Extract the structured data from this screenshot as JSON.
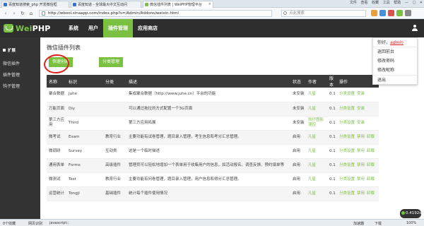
{
  "browser": {
    "tabs": [
      {
        "title": "百度知道搜索_php 开发微信框",
        "color": "#2e73d8"
      },
      {
        "title": "百度知道 - 全球最大中文互动问",
        "color": "#2e73d8"
      },
      {
        "title": "微信插件列表 | WeiPHP管理平台",
        "color": "#7ac142"
      }
    ],
    "window_controls": [
      "文件",
      "查看",
      "收藏",
      "工具",
      "帮助",
      "—",
      "□",
      "✕"
    ],
    "url": "http://wbool.sinaapp.com/index.php?s=/Admin/Addons/weixin.html",
    "search_placeholder": "点此搜索"
  },
  "app": {
    "logo_wei": "Wei",
    "logo_php": "PHP",
    "menu": [
      "系统",
      "用户",
      "插件管理",
      "应用商店"
    ],
    "active_menu": "插件管理"
  },
  "sidebar": {
    "heading": "扩展",
    "items": [
      "微信插件",
      "插件管理",
      "钩子管理"
    ]
  },
  "main": {
    "title": "微信插件列表",
    "quick_create": "快速创建",
    "category_manage": "分类管理",
    "columns": [
      "名称",
      "标识",
      "分类",
      "描述",
      "状态",
      "作者",
      "版本",
      "操作"
    ],
    "rows": [
      {
        "name": "聚合数据",
        "id": "Juhe",
        "cat": "",
        "desc": "集成聚合数据（http://www.juhe.cn）平台的功能",
        "status": "未安装",
        "author": "凡星",
        "ver": "0.1",
        "ops": [
          "分类设置",
          "安装"
        ]
      },
      {
        "name": "万能页面",
        "id": "Diy",
        "cat": "",
        "desc": "可以通过拖拉的方式配置一个3G页面",
        "status": "未安装",
        "author": "凡星",
        "ver": "0.1",
        "ops": [
          "分类设置",
          "安装"
        ]
      },
      {
        "name": "第三方应用",
        "id": "Third",
        "cat": "",
        "desc": "第三方应用拓展",
        "status": "未安装",
        "author": "凯仔图影漫控",
        "ver": "0.1",
        "ops": [
          "分类设置",
          "安装"
        ]
      },
      {
        "name": "微考试",
        "id": "Exam",
        "cat": "教育行业",
        "desc": "主要功能有试卷管理，题目录入管理，考生信息和考分汇总管理。",
        "status": "启用",
        "author": "凡星",
        "ver": "0.1",
        "ops": [
          "分类设置",
          "禁用",
          "卸载"
        ]
      },
      {
        "name": "微调研",
        "id": "Survey",
        "cat": "互动类",
        "desc": "这是一个临时描述",
        "status": "启用",
        "author": "凡星",
        "ver": "0.1",
        "ops": [
          "分类设置",
          "禁用",
          "卸载"
        ]
      },
      {
        "name": "通用表单",
        "id": "Forms",
        "cat": "高级插件",
        "desc": "管理员可以轻松地增加一个表单用于收集用户的信息，如活动报名、调查反馈、预约填单等",
        "status": "启用",
        "author": "凡星",
        "ver": "0.1",
        "ops": [
          "分类设置",
          "禁用",
          "卸载"
        ]
      },
      {
        "name": "微测试",
        "id": "Test",
        "cat": "教育行业",
        "desc": "主要功能有问卷管理，题目录入管理，用户信息和得分汇总管理。",
        "status": "启用",
        "author": "凡星",
        "ver": "0.1",
        "ops": [
          "分类设置",
          "禁用",
          "卸载"
        ]
      },
      {
        "name": "运营统计",
        "id": "Tongji",
        "cat": "基础插件",
        "desc": "统计每个插件使用情况",
        "status": "启用",
        "author": "凡星",
        "ver": "0.1",
        "ops": [
          "分类设置",
          "禁用",
          "卸载"
        ]
      }
    ]
  },
  "dropdown": {
    "greeting": "你好，",
    "username": "admin",
    "items": [
      "返回前台",
      "修改密码",
      "修改昵称",
      "退出"
    ]
  },
  "statusbar": {
    "left": "0个收藏",
    "guide": "网页识别",
    "status": "javascript:;",
    "zoom": "100%",
    "accel": "加速器",
    "download": "下载"
  },
  "speed_badge": "0.4192s",
  "colors": {
    "brand": "#7ac142",
    "nav_bg": "#2e2e2e",
    "annotation": "#d9241b"
  }
}
